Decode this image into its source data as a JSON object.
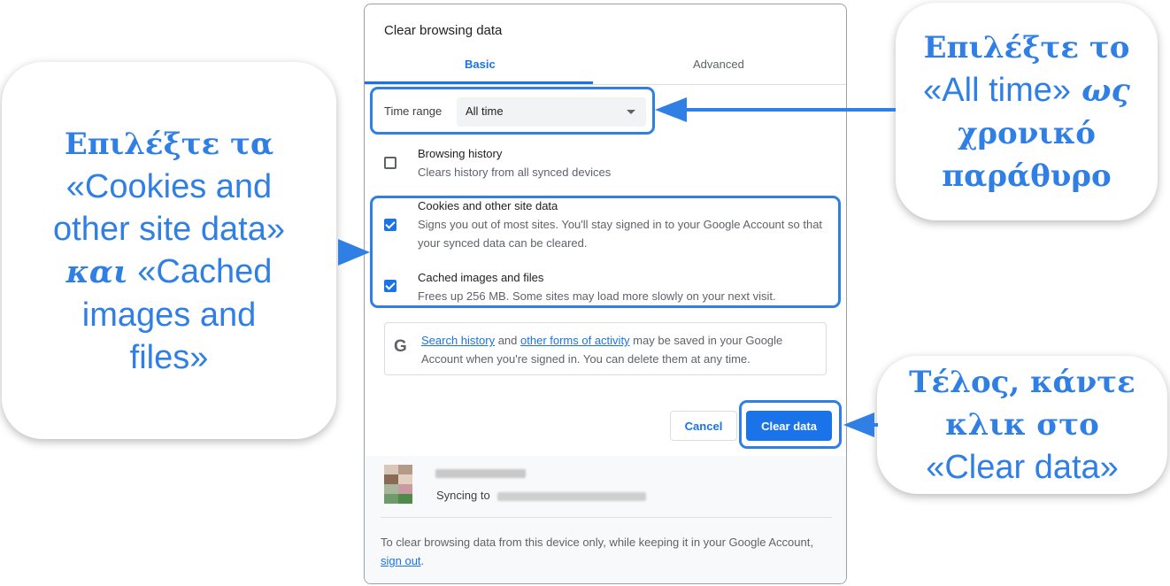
{
  "annotations": {
    "left": {
      "line1": "Επιλέξτε τα",
      "line2": "«Cookies and",
      "line3": "other site data»",
      "line4_greek": "και",
      "line4_rest": " «Cached",
      "line5": "images and",
      "line6": "files»"
    },
    "top_right": {
      "line1": "Επιλέξτε το",
      "line2_latin": "«All time»",
      "line2_greek": " ως",
      "line3": "χρονικό",
      "line4": "παράθυρο"
    },
    "bottom_right": {
      "line1": "Τέλος, κάντε",
      "line2": "κλικ στο",
      "line3": "«Clear data»"
    },
    "color": "#2f7fe5"
  },
  "dialog": {
    "title": "Clear browsing data",
    "tabs": [
      "Basic",
      "Advanced"
    ],
    "active_tab": "Basic",
    "time_range": {
      "label": "Time range",
      "value": "All time"
    },
    "items": [
      {
        "title": "Browsing history",
        "description": "Clears history from all synced devices",
        "checked": false
      },
      {
        "title": "Cookies and other site data",
        "description": "Signs you out of most sites. You'll stay signed in to your Google Account so that your synced data can be cleared.",
        "checked": true
      },
      {
        "title": "Cached images and files",
        "description": "Frees up 256 MB. Some sites may load more slowly on your next visit.",
        "checked": true
      }
    ],
    "info": {
      "icon": "google-g-icon",
      "link1": "Search history",
      "text1": " and ",
      "link2": "other forms of activity",
      "text2": " may be saved in your Google Account when you're signed in. You can delete them at any time."
    },
    "buttons": {
      "cancel": "Cancel",
      "clear": "Clear data"
    },
    "account": {
      "syncing_label": "Syncing to"
    },
    "footer": {
      "text": "To clear browsing data from this device only, while keeping it in your Google Account, ",
      "link": "sign out",
      "end": "."
    },
    "accent": "#1a73e8"
  }
}
